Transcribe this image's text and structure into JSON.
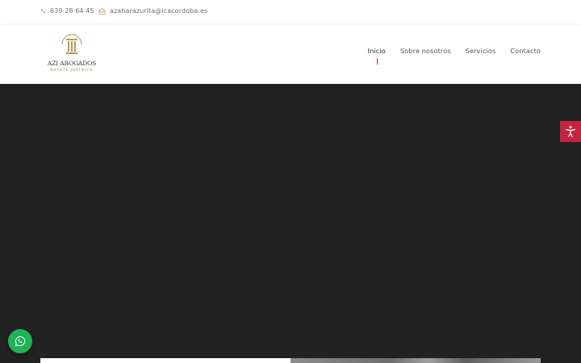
{
  "topbar": {
    "phone": "639 28 64 45",
    "separator": "·",
    "email": "azaharazurita@icacordoba.es"
  },
  "logo": {
    "brand": "AZI ABOGADOS",
    "tagline": "BUFETE JURÍDICO"
  },
  "nav": {
    "items": [
      {
        "label": "Inicio",
        "active": true
      },
      {
        "label": "Sobre nosotros"
      },
      {
        "label": "Servicios"
      },
      {
        "label": "Contacto"
      }
    ]
  },
  "icons": {
    "phone": "phone-icon",
    "email": "envelope-icon",
    "accessibility": "accessibility-icon",
    "whatsapp": "whatsapp-icon",
    "logo": "column-icon"
  },
  "colors": {
    "accent": "#c7233f",
    "gold": "#b8995a",
    "hero": "#222222",
    "whatsapp": "#1fb355"
  }
}
